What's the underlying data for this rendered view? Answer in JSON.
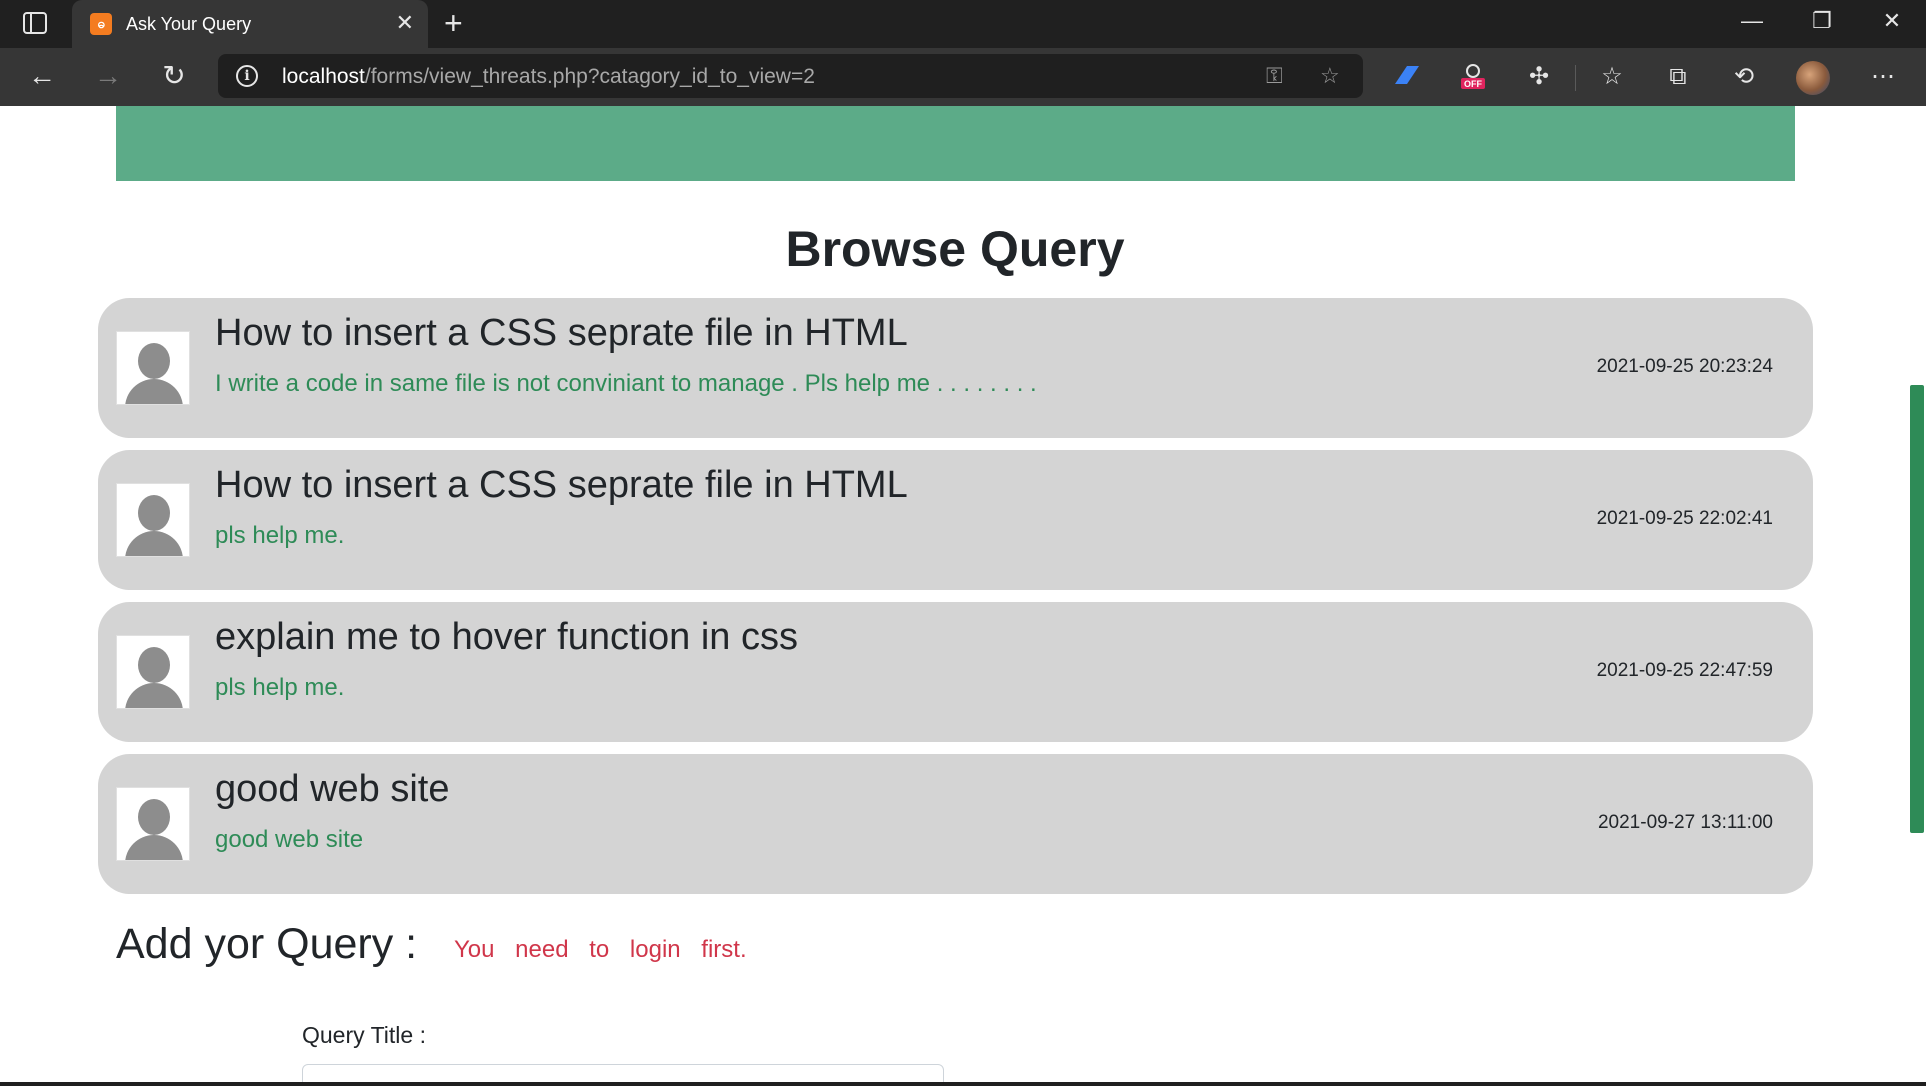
{
  "browser": {
    "tab_title": "Ask Your Query",
    "tab_favicon_text": "ဓ",
    "url_host": "localhost",
    "url_path": "/forms/view_threats.php?catagory_id_to_view=2",
    "icons": {
      "tab_actions": "tab-actions-icon",
      "close_tab": "close-icon",
      "new_tab": "plus-icon",
      "back": "arrow-left-icon",
      "forward": "arrow-right-icon",
      "refresh": "refresh-icon",
      "info": "info-icon",
      "key": "key-icon",
      "favorite_add": "star-plus-icon",
      "extensions": "puzzle-icon",
      "favorites": "favorites-icon",
      "collections": "collections-icon",
      "history": "history-icon",
      "menu": "more-icon"
    },
    "window_controls": [
      "minimize",
      "restore",
      "close"
    ]
  },
  "page": {
    "section_title": "Browse Query",
    "queries": [
      {
        "title": "How to insert a CSS seprate file in HTML",
        "description": "I write a code in same file is not conviniant to manage . Pls help me . . . . . . . .",
        "timestamp": "2021-09-25 20:23:24"
      },
      {
        "title": "How to insert a CSS seprate file in HTML",
        "description": "pls help me.",
        "timestamp": "2021-09-25 22:02:41"
      },
      {
        "title": "explain me to hover function in css",
        "description": "pls help me.",
        "timestamp": "2021-09-25 22:47:59"
      },
      {
        "title": "good web site",
        "description": "good web site",
        "timestamp": "2021-09-27 13:11:00"
      }
    ],
    "add_query": {
      "heading": "Add yor Query :",
      "login_message": "You need to login first.",
      "title_label": "Query Title :"
    }
  },
  "colors": {
    "banner": "#5cab88",
    "description_text": "#2e8b57",
    "login_message": "#d0364a",
    "card_background": "#d4d4d4"
  }
}
